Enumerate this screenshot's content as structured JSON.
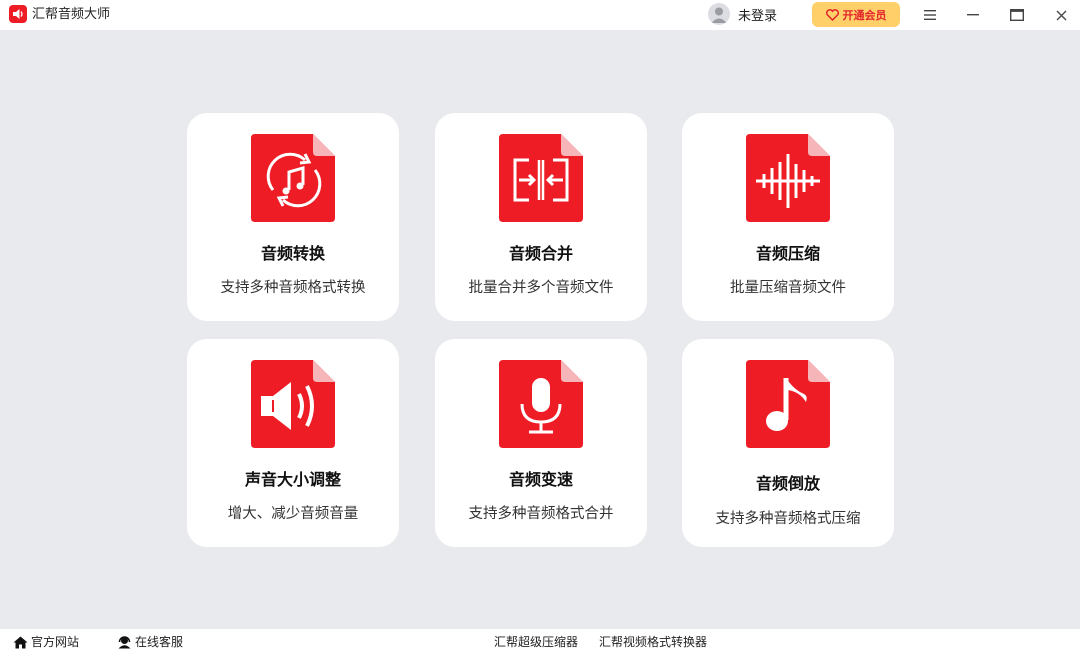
{
  "app": {
    "title": "汇帮音频大师",
    "user_label": "未登录",
    "vip_label": "开通会员"
  },
  "colors": {
    "accent_red": "#ee1c25",
    "vip_bg": "#ffcf6a",
    "page_bg": "#e9eaee"
  },
  "features": [
    {
      "title": "音频转换",
      "desc": "支持多种音频格式转换",
      "icon": "music-convert-icon"
    },
    {
      "title": "音频合并",
      "desc": "批量合并多个音频文件",
      "icon": "merge-icon"
    },
    {
      "title": "音频压缩",
      "desc": "批量压缩音频文件",
      "icon": "waveform-compress-icon"
    },
    {
      "title": "声音大小调整",
      "desc": "增大、减少音频音量",
      "icon": "speaker-volume-icon"
    },
    {
      "title": "音频变速",
      "desc": "支持多种音频格式合并",
      "icon": "microphone-icon"
    },
    {
      "title": "音频倒放",
      "desc": "支持多种音频格式压缩",
      "icon": "music-note-icon"
    }
  ],
  "footer": {
    "website": "官方网站",
    "support": "在线客服",
    "product1": "汇帮超级压缩器",
    "product2": "汇帮视频格式转换器"
  }
}
